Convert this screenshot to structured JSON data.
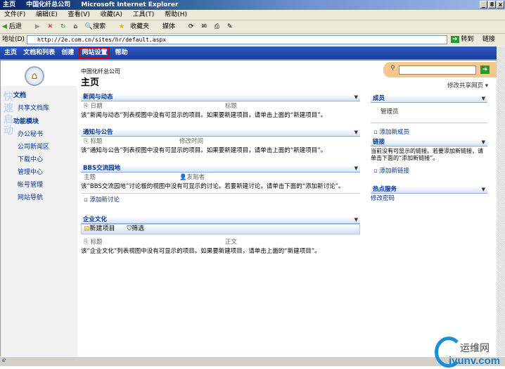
{
  "window": {
    "title": "主页",
    "site": "中国化纤总公司",
    "app": "Microsoft Internet Explorer",
    "buttons": [
      "_",
      "8",
      "x"
    ]
  },
  "menu": [
    "文件(F)",
    "编辑(E)",
    "查看(V)",
    "收藏(A)",
    "工具(T)",
    "帮助(H)"
  ],
  "toolbar": {
    "back": "后退",
    "search": "搜索",
    "favorites": "收藏夹",
    "media": "媒体"
  },
  "address": {
    "label": "地址(D)",
    "url": "http://2e.com.cn/sites/hr/default.aspx",
    "go": "转到",
    "links": "链接"
  },
  "sitenav": {
    "items": [
      "主页",
      "文档和列表",
      "创建",
      "网站设置",
      "帮助"
    ],
    "highlighted": "网站设置"
  },
  "leftnav": {
    "watermark": "快速启动",
    "groups": [
      {
        "title": "文档",
        "items": [
          "共享文档库"
        ]
      },
      {
        "title": "功能模块",
        "items": [
          "办公秘书",
          "公司新闻区",
          "下载中心",
          "管理中心",
          "帐号管理",
          "网站导航"
        ]
      }
    ]
  },
  "page": {
    "breadcrumb": "中国化纤总公司",
    "title": "主页",
    "modify_link": "修改共享网页"
  },
  "news": {
    "title": "新闻与动态",
    "cols": [
      "日期",
      "标题"
    ],
    "empty": "该“新闻与动态”列表视图中没有可显示的项目。如果要新建项目，请单击上面的“新建项目”。"
  },
  "notice": {
    "title": "通知与公告",
    "cols": [
      "标题",
      "修改时间"
    ],
    "empty": "该“通知与公告”列表视图中没有可显示的项目。如果要新建项目，请单击上面的“新建项目”。"
  },
  "bbs": {
    "title": "BBS交流园地",
    "cols": [
      "主题",
      "发贴者"
    ],
    "empty": "该“BBS交流园地”讨论板的视图中没有可显示的讨论。若要新建讨论，请单击下面的“添加新讨论”。",
    "add": "添加新讨论"
  },
  "culture": {
    "title": "企业文化",
    "new": "新建项目",
    "filter": "筛选",
    "cols": [
      "标题",
      "正文"
    ],
    "empty": "该“企业文化”列表视图中没有可显示的项目。如果要新建项目，请单击上面的“新建项目”。"
  },
  "members": {
    "title": "成员",
    "items": [
      "管理员"
    ],
    "add": "添加新成员"
  },
  "links": {
    "title": "链接",
    "empty": "当前没有可显示的链接。若要添加新链接，请单击下面的“添加新链接”。",
    "add": "添加新链接"
  },
  "hot": {
    "title": "热点服务",
    "items": [
      "修改密码"
    ]
  },
  "brand": {
    "name": "运维网",
    "domain": "iyunv.com"
  }
}
